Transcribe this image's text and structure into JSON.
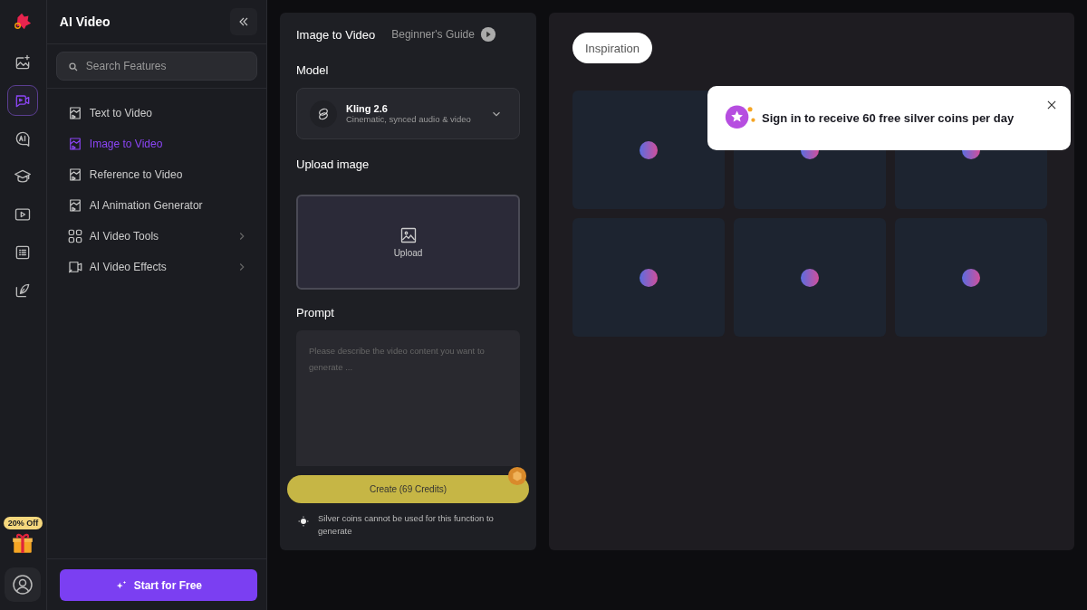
{
  "rail": {
    "items": [
      {
        "selected": false
      },
      {
        "selected": true
      },
      {
        "selected": false
      },
      {
        "selected": false
      },
      {
        "selected": false
      },
      {
        "selected": false
      },
      {
        "selected": false
      }
    ],
    "promo_badge": "20% Off"
  },
  "sidebar": {
    "title": "AI Video",
    "search": {
      "placeholder": "Search Features"
    },
    "items": [
      {
        "label": "Text to Video",
        "kind": "page",
        "selected": false
      },
      {
        "label": "Image to Video",
        "kind": "page",
        "selected": true
      },
      {
        "label": "Reference to Video",
        "kind": "page",
        "selected": false
      },
      {
        "label": "AI Animation Generator",
        "kind": "page",
        "selected": false
      },
      {
        "label": "AI Video Tools",
        "kind": "grid",
        "selected": false
      },
      {
        "label": "AI Video Effects",
        "kind": "effects",
        "selected": false
      }
    ],
    "start_button": "Start for Free"
  },
  "form": {
    "title": "Image to Video",
    "guide_link": "Beginner's Guide",
    "model_label": "Model",
    "model": {
      "name": "Kling 2.6",
      "description": "Cinematic, synced audio & video"
    },
    "upload_label": "Upload image",
    "upload_button": "Upload",
    "prompt_label": "Prompt",
    "prompt": {
      "placeholder": "Please describe the video content you want to generate ..."
    },
    "create_button": "Create (69 Credits)",
    "note": "Silver coins cannot be used for this function to generate"
  },
  "gallery": {
    "tab": "Inspiration",
    "tiles": [
      {
        "kind": "loading"
      },
      {
        "kind": "loading"
      },
      {
        "kind": "loading"
      },
      {
        "kind": "loading"
      },
      {
        "kind": "loading"
      },
      {
        "kind": "loading"
      }
    ]
  },
  "toast": {
    "message": "Sign in to receive 60 free silver coins per day"
  }
}
